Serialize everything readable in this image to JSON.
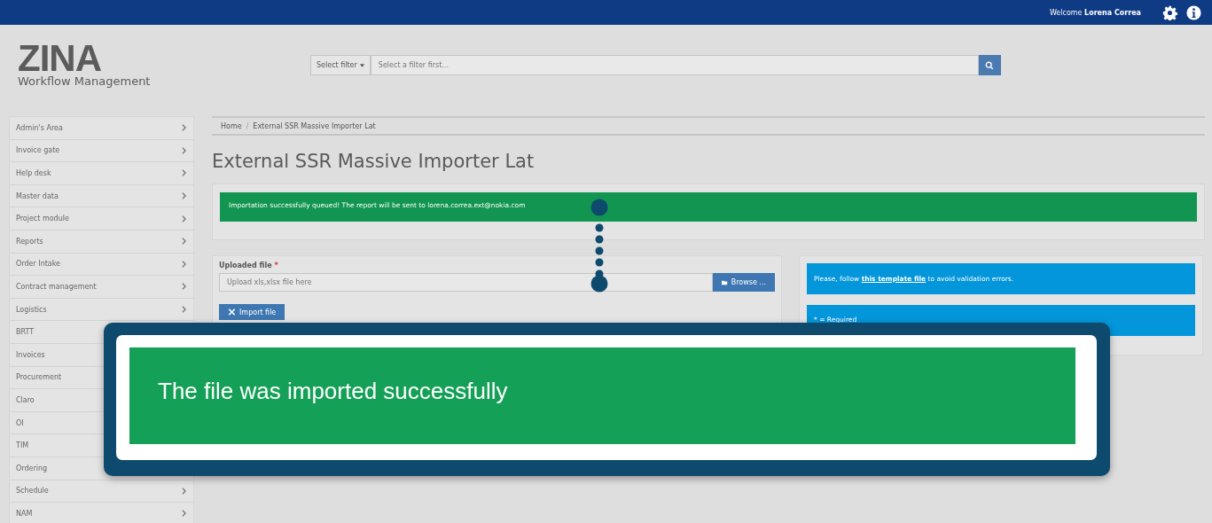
{
  "top_bar": {
    "welcome": "Welcome",
    "user": "Lorena Correa"
  },
  "logo": {
    "name": "ZINA",
    "subtitle": "Workflow Management"
  },
  "search": {
    "filter_label": "Select filter",
    "placeholder": "Select a filter first..."
  },
  "sidebar": {
    "items": [
      {
        "label": "Admin's Area"
      },
      {
        "label": "Invoice gate"
      },
      {
        "label": "Help desk"
      },
      {
        "label": "Master data"
      },
      {
        "label": "Project module"
      },
      {
        "label": "Reports"
      },
      {
        "label": "Order Intake"
      },
      {
        "label": "Contract management"
      },
      {
        "label": "Logistics"
      },
      {
        "label": "BRTT"
      },
      {
        "label": "Invoices"
      },
      {
        "label": "Procurement"
      },
      {
        "label": "Claro"
      },
      {
        "label": "OI"
      },
      {
        "label": "TIM"
      },
      {
        "label": "Ordering"
      },
      {
        "label": "Schedule"
      },
      {
        "label": "NAM"
      }
    ]
  },
  "breadcrumb": {
    "items": [
      "Home",
      "External SSR Massive Importer Lat"
    ],
    "separator": "/"
  },
  "page_title": "External SSR Massive Importer Lat",
  "alert": "Importation successfully queued! The report will be sent to lorena.correa.ext@nokia.com",
  "form": {
    "label": "Uploaded file",
    "required_mark": "*",
    "placeholder": "Upload xls,xlsx file here",
    "browse": "Browse ...",
    "import": "Import file"
  },
  "info": {
    "text": "Please, follow **this template file** to avoid validation errors.",
    "required_note": "* = Required"
  },
  "callout": {
    "text": "The file was imported successfully"
  }
}
